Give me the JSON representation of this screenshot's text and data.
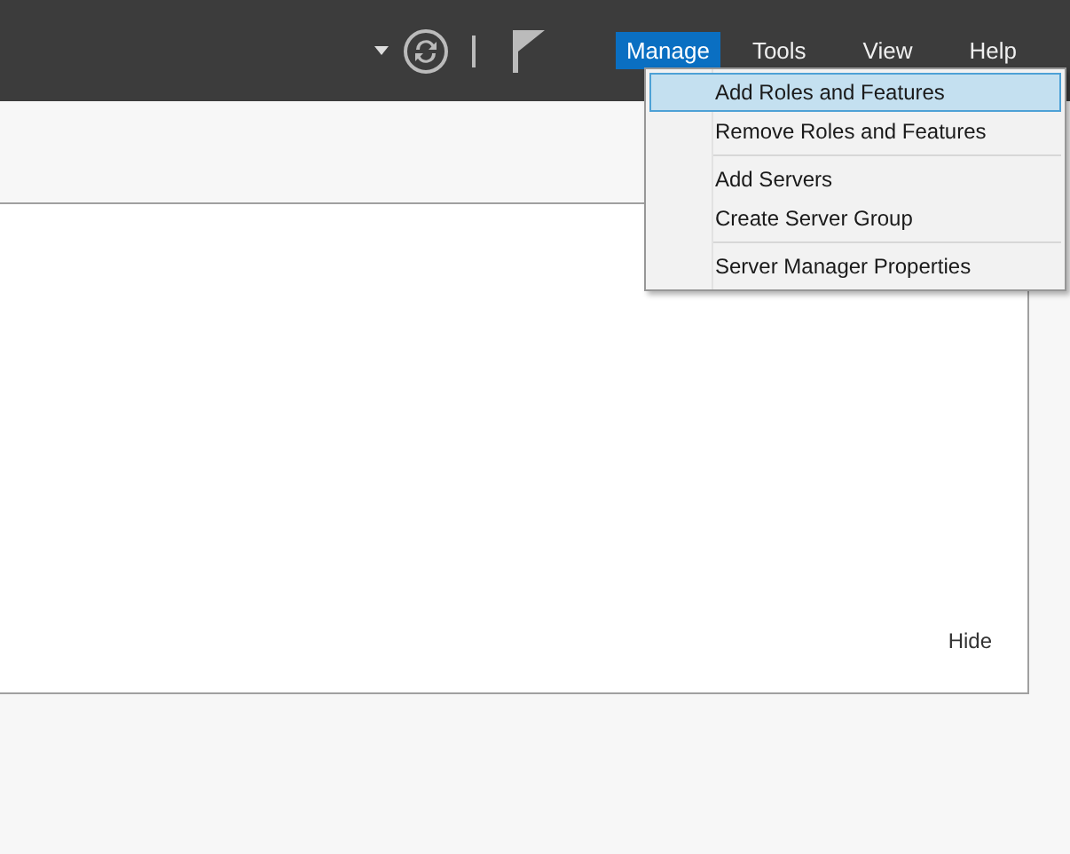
{
  "menu_bar": [
    {
      "label": "Manage",
      "selected": true
    },
    {
      "label": "Tools",
      "selected": false
    },
    {
      "label": "View",
      "selected": false
    },
    {
      "label": "Help",
      "selected": false
    }
  ],
  "dropdown_menu": [
    {
      "kind": "item",
      "label": "Add Roles and Features",
      "selected": true
    },
    {
      "kind": "item",
      "label": "Remove Roles and Features",
      "selected": false
    },
    {
      "kind": "separator"
    },
    {
      "kind": "item",
      "label": "Add Servers",
      "selected": false
    },
    {
      "kind": "item",
      "label": "Create Server Group",
      "selected": false
    },
    {
      "kind": "separator"
    },
    {
      "kind": "item",
      "label": "Server Manager Properties",
      "selected": false
    }
  ],
  "panel": {
    "hide_link": "Hide"
  }
}
